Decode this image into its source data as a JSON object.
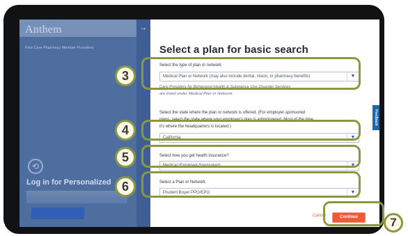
{
  "background": {
    "logo": "Anthem",
    "nav_text": "Find Care  Pharmacy  Member  Providers",
    "login_text": "Log in for Personalized"
  },
  "navigation": {
    "arrow_icon": "→"
  },
  "modal": {
    "title": "Select a plan for basic search",
    "plan_type_label": "Select the type of plan or network",
    "plan_type_value": "Medical Plan or Network (may also include dental, vision, or pharmacy benefits)",
    "helper_line_1": "Care Providers for Behavioral Health & Substance Use Disorder Services",
    "helper_line_2": "are listed under Medical Plan or Network.",
    "state_line_1": "Select the state where the plan or network is offered. (For employer-sponsored",
    "state_line_2": "plans, select the state where your employer's plan is administered. Most of the time",
    "state_line_3": "it's where the headquarters is located.)",
    "state_value": "California",
    "insurance_label": "Select how you get health insurance?",
    "insurance_value": "Medical (Employer-Sponsored)",
    "plan_network_label": "Select a Plan or Network",
    "plan_network_value": "Prudent Buyer PPO/EPO",
    "cancel_label": "Cancel",
    "continue_label": "Continue"
  },
  "feedback": {
    "label": "Feedback"
  },
  "callouts": {
    "step_3": "3",
    "step_4": "4",
    "step_5": "5",
    "step_6": "6",
    "step_7": "7"
  },
  "icons": {
    "dropdown": "▼",
    "circle_arrow": "⟲"
  },
  "colors": {
    "brand_blue": "#1f67ad",
    "continue_orange": "#ef5a35",
    "callout_olive": "#8b9840"
  }
}
